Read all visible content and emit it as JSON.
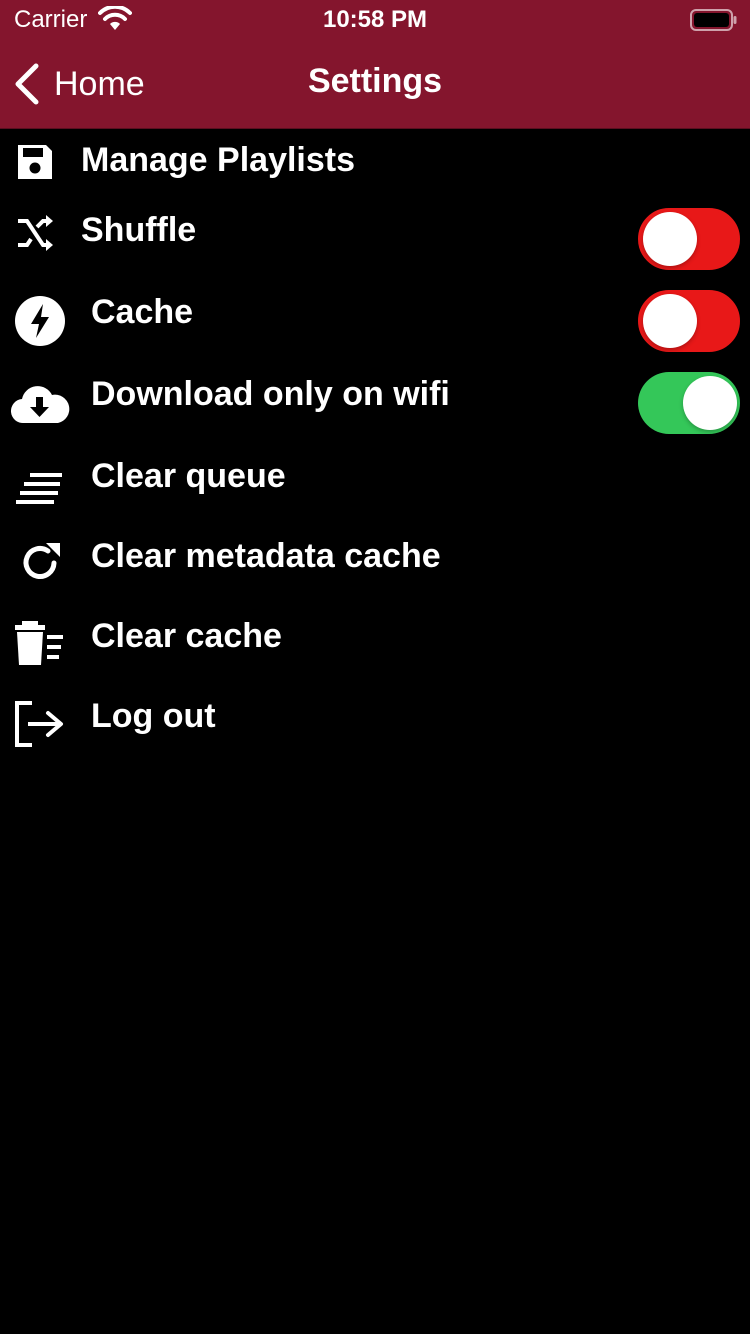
{
  "status_bar": {
    "carrier": "Carrier",
    "time": "10:58 PM"
  },
  "nav": {
    "back_label": "Home",
    "title": "Settings",
    "bar_color": "#84152d"
  },
  "settings": {
    "manage_playlists": {
      "label": "Manage Playlists",
      "icon": "save-icon"
    },
    "shuffle": {
      "label": "Shuffle",
      "icon": "shuffle-icon",
      "toggle": false
    },
    "cache": {
      "label": "Cache",
      "icon": "lightning-icon",
      "toggle": false
    },
    "download_wifi": {
      "label": "Download only on wifi",
      "icon": "cloud-download-icon",
      "toggle": true
    },
    "clear_queue": {
      "label": "Clear queue",
      "icon": "queue-lines-icon"
    },
    "clear_metadata_cache": {
      "label": "Clear metadata cache",
      "icon": "refresh-icon"
    },
    "clear_cache": {
      "label": "Clear cache",
      "icon": "trash-list-icon"
    },
    "log_out": {
      "label": "Log out",
      "icon": "logout-icon"
    }
  },
  "colors": {
    "toggle_off": "#e81818",
    "toggle_on": "#34c759",
    "background": "#000000"
  }
}
